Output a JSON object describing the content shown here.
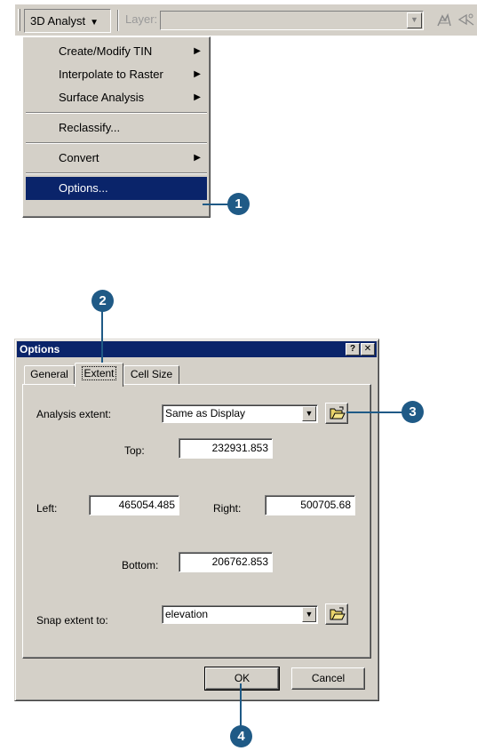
{
  "toolbar": {
    "menu_label": "3D Analyst",
    "menu_arrow": "▼",
    "layer_label": "Layer:",
    "layer_value": "",
    "layer_dropdown_glyph": "▼",
    "icon1": "dig-icon",
    "icon2": "line-of-sight-icon"
  },
  "menu": {
    "items": [
      {
        "label": "Create/Modify TIN",
        "submenu": true
      },
      {
        "label": "Interpolate to Raster",
        "submenu": true
      },
      {
        "label": "Surface Analysis",
        "submenu": true
      },
      {
        "label": "Reclassify...",
        "submenu": false
      },
      {
        "label": "Convert",
        "submenu": true
      },
      {
        "label": "Options...",
        "submenu": false,
        "selected": true
      }
    ],
    "submenu_glyph": "▶"
  },
  "callouts": [
    "1",
    "2",
    "3",
    "4"
  ],
  "dialog": {
    "title": "Options",
    "help_glyph": "?",
    "close_glyph": "✕",
    "tabs": [
      "General",
      "Extent",
      "Cell Size"
    ],
    "active_tab": "Extent",
    "analysis_extent_label": "Analysis extent:",
    "analysis_extent_value": "Same as Display",
    "top_label": "Top:",
    "top_value": "232931.853",
    "left_label": "Left:",
    "left_value": "465054.485",
    "right_label": "Right:",
    "right_value": "500705.68",
    "bottom_label": "Bottom:",
    "bottom_value": "206762.853",
    "snap_label": "Snap extent to:",
    "snap_value": "elevation",
    "dropdown_glyph": "▼",
    "ok_label": "OK",
    "cancel_label": "Cancel"
  },
  "colors": {
    "face": "#d4d0c8",
    "selection": "#0a246a",
    "callout": "#1f5a86"
  }
}
